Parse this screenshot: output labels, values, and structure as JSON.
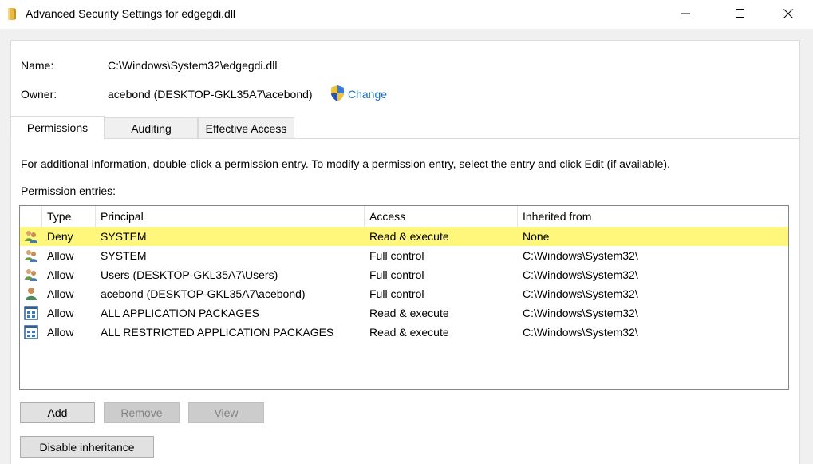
{
  "window": {
    "title": "Advanced Security Settings for edgegdi.dll",
    "icon": "folder-icon",
    "minimize_glyph": "—",
    "maximize_glyph": "☐",
    "close_glyph": "✕"
  },
  "details": {
    "name_label": "Name:",
    "name_value": "C:\\Windows\\System32\\edgegdi.dll",
    "owner_label": "Owner:",
    "owner_value": "acebond (DESKTOP-GKL35A7\\acebond)",
    "change_link": "Change",
    "change_icon": "uac-shield-icon"
  },
  "tabs": [
    {
      "label": "Permissions",
      "active": true
    },
    {
      "label": "Auditing",
      "active": false
    },
    {
      "label": "Effective Access",
      "active": false
    }
  ],
  "permissions": {
    "info_text": "For additional information, double-click a permission entry. To modify a permission entry, select the entry and click Edit (if available).",
    "entries_label": "Permission entries:",
    "columns": [
      "Type",
      "Principal",
      "Access",
      "Inherited from"
    ],
    "rows": [
      {
        "icon": "group-users-icon",
        "type": "Deny",
        "principal": "SYSTEM",
        "access": "Read & execute",
        "inherited": "None",
        "selected": true
      },
      {
        "icon": "group-users-icon",
        "type": "Allow",
        "principal": "SYSTEM",
        "access": "Full control",
        "inherited": "C:\\Windows\\System32\\",
        "selected": false
      },
      {
        "icon": "group-users-icon",
        "type": "Allow",
        "principal": "Users (DESKTOP-GKL35A7\\Users)",
        "access": "Full control",
        "inherited": "C:\\Windows\\System32\\",
        "selected": false
      },
      {
        "icon": "single-user-icon",
        "type": "Allow",
        "principal": "acebond (DESKTOP-GKL35A7\\acebond)",
        "access": "Full control",
        "inherited": "C:\\Windows\\System32\\",
        "selected": false
      },
      {
        "icon": "app-package-icon",
        "type": "Allow",
        "principal": "ALL APPLICATION PACKAGES",
        "access": "Read & execute",
        "inherited": "C:\\Windows\\System32\\",
        "selected": false
      },
      {
        "icon": "app-package-icon",
        "type": "Allow",
        "principal": "ALL RESTRICTED APPLICATION PACKAGES",
        "access": "Read & execute",
        "inherited": "C:\\Windows\\System32\\",
        "selected": false
      }
    ]
  },
  "buttons": {
    "add": "Add",
    "remove": "Remove",
    "view": "View",
    "disable_inheritance": "Disable inheritance"
  },
  "colors": {
    "selected_row": "#fff77b",
    "link": "#1f6fc5",
    "dialog_bg": "#f0f0f0"
  }
}
